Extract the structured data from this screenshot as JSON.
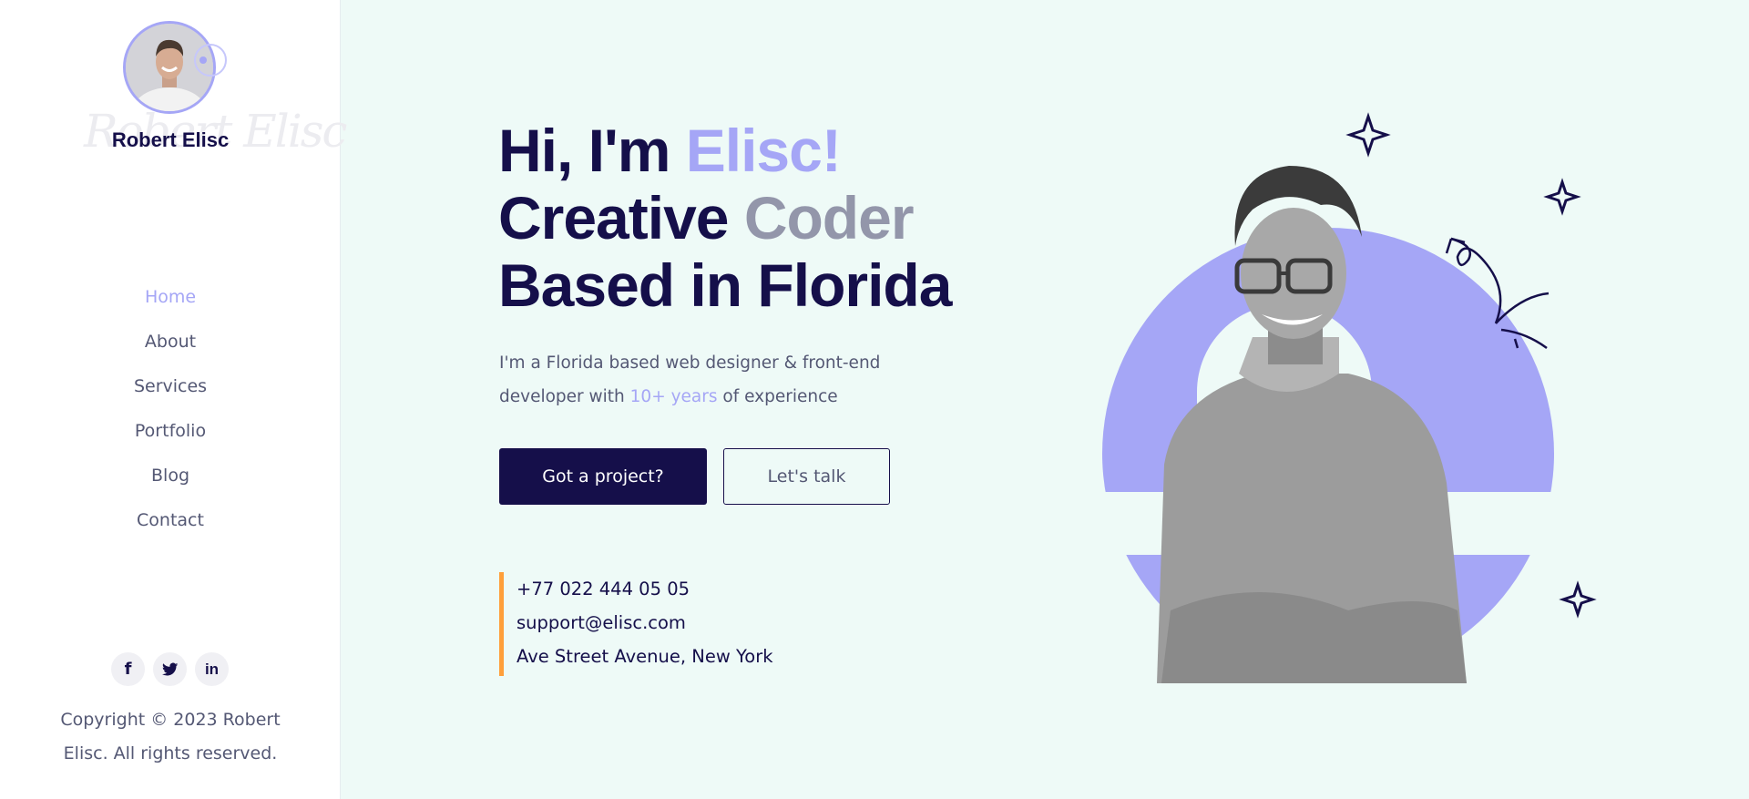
{
  "sidebar": {
    "name": "Robert Elisc",
    "signature": "Robert Elisc",
    "nav": [
      {
        "label": "Home",
        "active": true
      },
      {
        "label": "About",
        "active": false
      },
      {
        "label": "Services",
        "active": false
      },
      {
        "label": "Portfolio",
        "active": false
      },
      {
        "label": "Blog",
        "active": false
      },
      {
        "label": "Contact",
        "active": false
      }
    ],
    "socials": [
      {
        "icon": "facebook-icon",
        "glyph": "f"
      },
      {
        "icon": "twitter-icon",
        "glyph": ""
      },
      {
        "icon": "linkedin-icon",
        "glyph": "in"
      }
    ],
    "copyright_line1": "Copyright © 2023 Robert",
    "copyright_line2": "Elisc. All rights reserved."
  },
  "hero": {
    "greeting": "Hi, I'm ",
    "name": "Elisc!",
    "role_1": "Creative ",
    "role_2": "Coder",
    "location": "Based in Florida",
    "desc_line1": "I'm a Florida based web designer & front-end",
    "desc_line2_pre": "developer with ",
    "desc_highlight": "10+ years",
    "desc_line2_post": " of experience",
    "primary_button": "Got a project?",
    "secondary_button": "Let's talk"
  },
  "contact": {
    "phone": "+77 022 444 05 05",
    "email": "support@elisc.com",
    "address": "Ave Street Avenue, New York"
  },
  "colors": {
    "navy": "#150f4a",
    "accent": "#a5a6f6",
    "orange": "#ff9f3a",
    "bg": "#eefaf7"
  }
}
